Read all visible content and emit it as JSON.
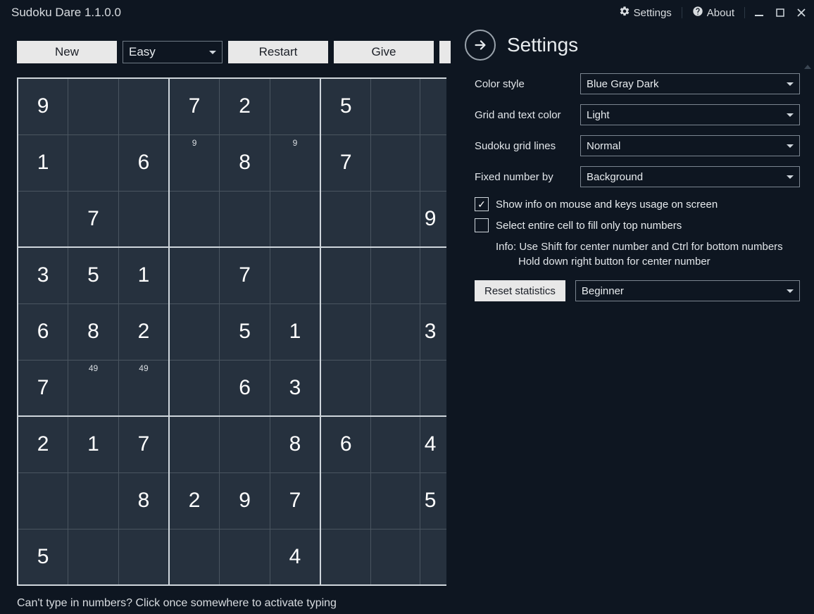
{
  "app": {
    "title": "Sudoku Dare 1.1.0.0"
  },
  "titlebar": {
    "settings": "Settings",
    "about": "About"
  },
  "toolbar": {
    "new": "New",
    "difficulty": "Easy",
    "restart": "Restart",
    "give": "Give"
  },
  "grid": {
    "cells": [
      [
        "9",
        "",
        "",
        "7",
        "2",
        "",
        "5",
        ""
      ],
      [
        "1",
        "",
        "6",
        "",
        "8",
        "",
        "7",
        ""
      ],
      [
        "",
        "7",
        "",
        "",
        "",
        "",
        "",
        ""
      ],
      [
        "3",
        "5",
        "1",
        "",
        "7",
        "",
        "",
        ""
      ],
      [
        "6",
        "8",
        "2",
        "",
        "5",
        "1",
        "",
        ""
      ],
      [
        "7",
        "",
        "",
        "",
        "6",
        "3",
        "",
        ""
      ],
      [
        "2",
        "1",
        "7",
        "",
        "",
        "8",
        "6",
        ""
      ],
      [
        "",
        "",
        "8",
        "2",
        "9",
        "7",
        "",
        ""
      ],
      [
        "5",
        "",
        "",
        "",
        "",
        "4",
        "",
        ""
      ]
    ],
    "pencils": {
      "1-3": "9",
      "1-5": "9",
      "5-1": "49",
      "5-2": "49"
    },
    "edgeCells": [
      "",
      "",
      "9",
      "",
      "3",
      "",
      "4",
      "5",
      ""
    ]
  },
  "hint": "Can't type in numbers? Click once somewhere to activate typing",
  "settings": {
    "title": "Settings",
    "colorStyle": {
      "label": "Color style",
      "value": "Blue Gray Dark"
    },
    "gridTextColor": {
      "label": "Grid and text color",
      "value": "Light"
    },
    "gridLines": {
      "label": "Sudoku grid lines",
      "value": "Normal"
    },
    "fixedNumber": {
      "label": "Fixed number by",
      "value": "Background"
    },
    "showInfo": {
      "label": "Show info on mouse and keys usage on screen",
      "checked": true
    },
    "selectEntire": {
      "label": "Select entire cell to fill only top numbers",
      "checked": false
    },
    "infoLine1": "Info: Use Shift for center number and Ctrl for bottom numbers",
    "infoLine2": "Hold down right button for center number",
    "reset": {
      "button": "Reset statistics",
      "value": "Beginner"
    }
  }
}
